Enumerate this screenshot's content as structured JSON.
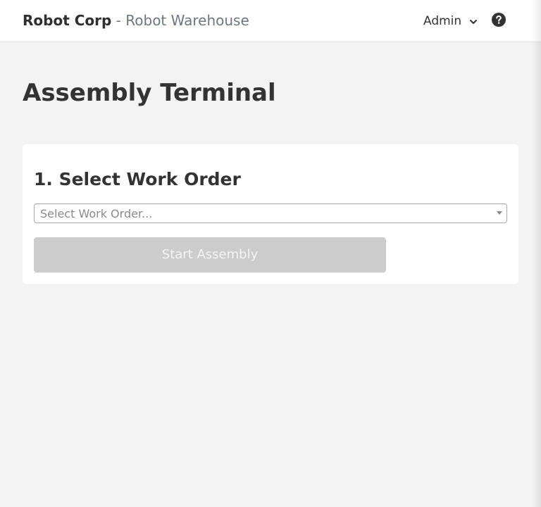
{
  "header": {
    "company": "Robot Corp",
    "separator": " - ",
    "app_name": "Robot Warehouse",
    "user_menu": {
      "label": "Admin",
      "icon": "chevron-down-icon"
    },
    "help_icon": "question-circle-icon"
  },
  "page": {
    "title": "Assembly Terminal"
  },
  "work_order_card": {
    "title": "1. Select Work Order",
    "select": {
      "placeholder": "Select Work Order...",
      "value": ""
    },
    "start_button": {
      "label": "Start Assembly",
      "disabled": true
    }
  },
  "colors": {
    "background": "#f3f3f3",
    "header_bg": "#ffffff",
    "card_bg": "#ffffff",
    "text": "#333333",
    "muted_text": "#6f7680",
    "disabled_button": "#cccccc"
  }
}
